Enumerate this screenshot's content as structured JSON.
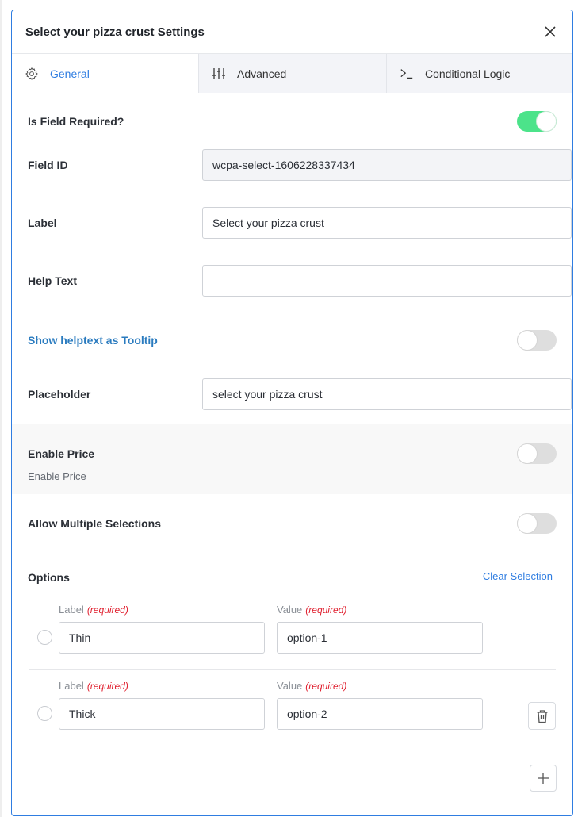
{
  "modal": {
    "title": "Select your pizza crust Settings",
    "close_icon": "close-icon"
  },
  "tabs": [
    {
      "label": "General",
      "icon": "gear-icon",
      "active": true
    },
    {
      "label": "Advanced",
      "icon": "sliders-icon",
      "active": false
    },
    {
      "label": "Conditional Logic",
      "icon": "terminal-prompt-icon",
      "active": false
    }
  ],
  "fields": {
    "is_required": {
      "label": "Is Field Required?",
      "enabled": true
    },
    "field_id": {
      "label": "Field ID",
      "value": "wcpa-select-1606228337434"
    },
    "label": {
      "label": "Label",
      "value": "Select your pizza crust"
    },
    "help_text": {
      "label": "Help Text",
      "value": ""
    },
    "tooltip": {
      "label": "Show helptext as Tooltip",
      "enabled": false
    },
    "placeholder": {
      "label": "Placeholder",
      "value": "select your pizza crust"
    },
    "enable_price": {
      "label": "Enable Price",
      "sublabel": "Enable Price",
      "enabled": false
    },
    "multiple": {
      "label": "Allow Multiple Selections",
      "enabled": false
    }
  },
  "options": {
    "heading": "Options",
    "clear_label": "Clear Selection",
    "label_header": "Label",
    "value_header": "Value",
    "required_tag": "(required)",
    "items": [
      {
        "label": "Thin",
        "value": "option-1",
        "selected": false,
        "deletable": false
      },
      {
        "label": "Thick",
        "value": "option-2",
        "selected": false,
        "deletable": true
      }
    ],
    "add_icon": "plus-icon",
    "delete_icon": "trash-icon"
  },
  "colors": {
    "accent": "#2f7de1",
    "toggle_on": "#4ce38a",
    "required": "#e0202f",
    "tooltip_label": "#2a7bbf"
  }
}
